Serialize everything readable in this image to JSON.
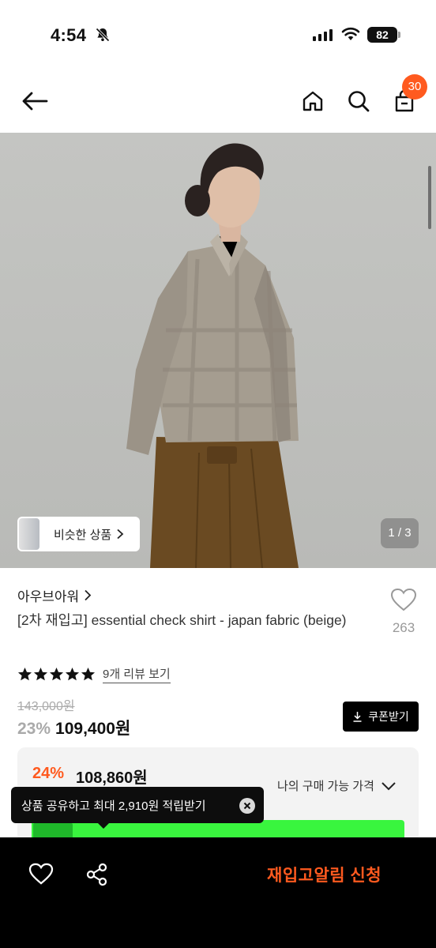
{
  "status_bar": {
    "time": "4:54",
    "battery": "82"
  },
  "header": {
    "cart_count": "30"
  },
  "colors": {
    "accent": "#ff5a1f",
    "promo_green": "#39f53e",
    "muted": "#aaaaaa"
  },
  "icons": [
    "bell-off-icon",
    "signal-icon",
    "wifi-icon",
    "back-arrow-icon",
    "home-icon",
    "search-icon",
    "cart-icon",
    "chevron-right-icon",
    "heart-icon",
    "star-icon",
    "download-icon",
    "chevron-down-icon",
    "close-icon",
    "share-icon"
  ],
  "gallery": {
    "similar_label": "비슷한 상품",
    "counter": "1 / 3"
  },
  "product": {
    "brand": "아우브아워",
    "title": "[2차 재입고] essential check shirt - japan fabric (beige)",
    "likes": "263",
    "rating_stars": 5,
    "review_link": "9개 리뷰 보기",
    "original_price": "143,000원",
    "discount_rate": "23%",
    "sale_price": "109,400원",
    "coupon_label": "쿠폰받기"
  },
  "my_price": {
    "rate": "24%",
    "price": "108,860원",
    "toggle_label": "나의 구매 가능 가격"
  },
  "toast": {
    "message": "상품 공유하고 최대 2,910원 적립받기"
  },
  "bottom_bar": {
    "restock_label": "재입고알림 신청"
  }
}
